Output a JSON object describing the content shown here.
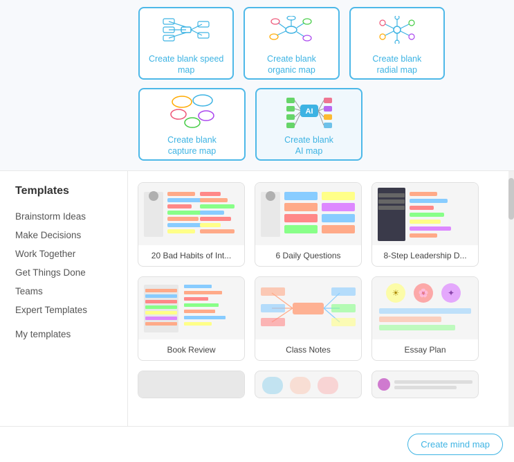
{
  "top_row": {
    "cards": [
      {
        "label": "Create blank\nspeed map",
        "id": "speed-map"
      },
      {
        "label": "Create blank\norganic map",
        "id": "organic-map"
      },
      {
        "label": "Create blank\nradial map",
        "id": "radial-map"
      }
    ]
  },
  "second_row": {
    "cards": [
      {
        "label": "Create blank\ncapture map",
        "id": "capture-map"
      },
      {
        "label": "Create blank\nAI map",
        "id": "ai-map"
      }
    ]
  },
  "sidebar": {
    "templates_title": "Templates",
    "items": [
      {
        "label": "Brainstorm Ideas",
        "id": "brainstorm-ideas"
      },
      {
        "label": "Make Decisions",
        "id": "make-decisions"
      },
      {
        "label": "Work Together",
        "id": "work-together"
      },
      {
        "label": "Get Things Done",
        "id": "get-things-done"
      },
      {
        "label": "Teams",
        "id": "teams"
      },
      {
        "label": "Expert Templates",
        "id": "expert-templates"
      }
    ],
    "my_templates_label": "My templates"
  },
  "templates": {
    "items": [
      {
        "name": "20 Bad Habits of Int...",
        "id": "bad-habits"
      },
      {
        "name": "6 Daily Questions",
        "id": "daily-questions"
      },
      {
        "name": "8-Step Leadership D...",
        "id": "leadership"
      },
      {
        "name": "Book Review",
        "id": "book-review"
      },
      {
        "name": "Class Notes",
        "id": "class-notes"
      },
      {
        "name": "Essay Plan",
        "id": "essay-plan"
      }
    ]
  },
  "bottom": {
    "create_button_label": "Create mind map"
  }
}
